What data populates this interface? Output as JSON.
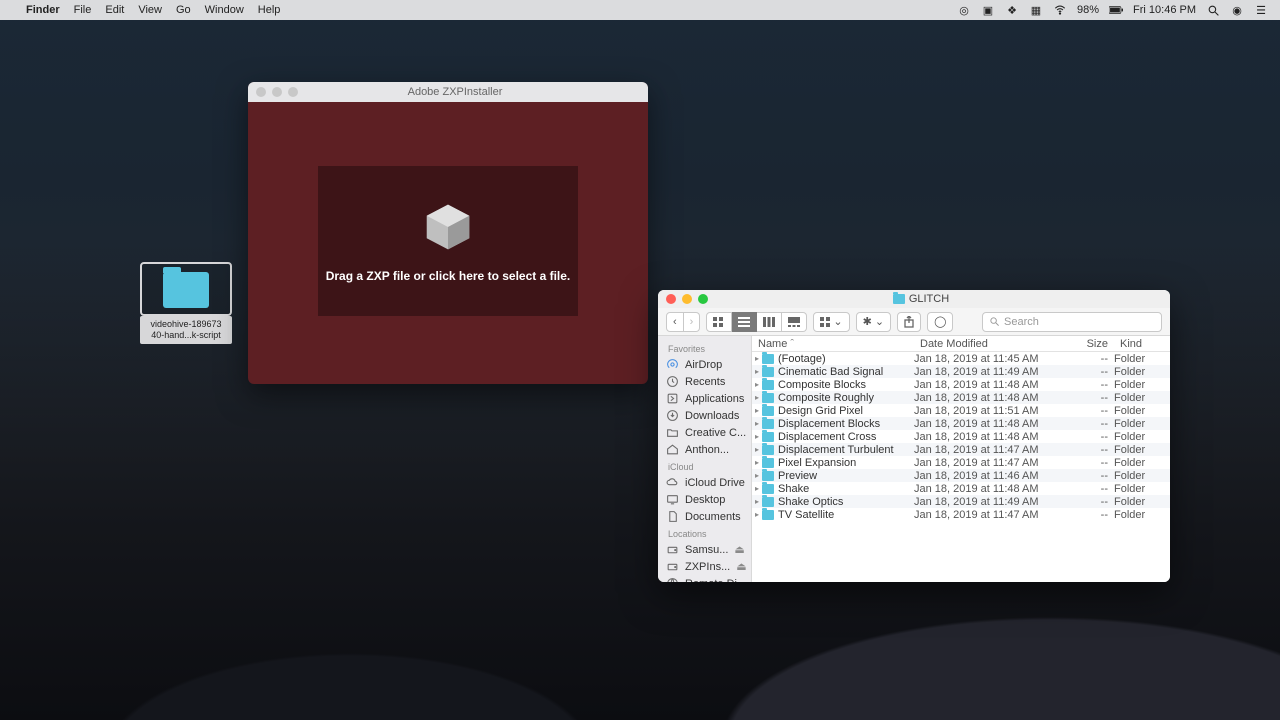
{
  "menubar": {
    "app": "Finder",
    "items": [
      "File",
      "Edit",
      "View",
      "Go",
      "Window",
      "Help"
    ],
    "battery": "98%",
    "clock": "Fri 10:46 PM"
  },
  "desktop": {
    "folder_label": "videohive-189673\n40-hand...k-script"
  },
  "zxp": {
    "title": "Adobe ZXPInstaller",
    "message": "Drag a ZXP file or click here to select a file."
  },
  "finder": {
    "title": "GLITCH",
    "search_placeholder": "Search",
    "sidebar": {
      "groups": [
        {
          "head": "Favorites",
          "items": [
            {
              "icon": "airdrop",
              "label": "AirDrop"
            },
            {
              "icon": "clock",
              "label": "Recents"
            },
            {
              "icon": "app",
              "label": "Applications"
            },
            {
              "icon": "download",
              "label": "Downloads"
            },
            {
              "icon": "folder",
              "label": "Creative C..."
            },
            {
              "icon": "home",
              "label": "Anthon..."
            }
          ]
        },
        {
          "head": "iCloud",
          "items": [
            {
              "icon": "cloud",
              "label": "iCloud Drive"
            },
            {
              "icon": "desktop",
              "label": "Desktop"
            },
            {
              "icon": "doc",
              "label": "Documents"
            }
          ]
        },
        {
          "head": "Locations",
          "items": [
            {
              "icon": "disk",
              "label": "Samsu...",
              "eject": true
            },
            {
              "icon": "disk",
              "label": "ZXPIns...",
              "eject": true
            },
            {
              "icon": "net",
              "label": "Remote Di..."
            }
          ]
        }
      ]
    },
    "columns": {
      "name": "Name",
      "date": "Date Modified",
      "size": "Size",
      "kind": "Kind"
    },
    "rows": [
      {
        "name": "(Footage)",
        "date": "Jan 18, 2019 at 11:45 AM",
        "size": "--",
        "kind": "Folder"
      },
      {
        "name": "Cinematic Bad Signal",
        "date": "Jan 18, 2019 at 11:49 AM",
        "size": "--",
        "kind": "Folder"
      },
      {
        "name": "Composite Blocks",
        "date": "Jan 18, 2019 at 11:48 AM",
        "size": "--",
        "kind": "Folder"
      },
      {
        "name": "Composite Roughly",
        "date": "Jan 18, 2019 at 11:48 AM",
        "size": "--",
        "kind": "Folder"
      },
      {
        "name": "Design Grid Pixel",
        "date": "Jan 18, 2019 at 11:51 AM",
        "size": "--",
        "kind": "Folder"
      },
      {
        "name": "Displacement Blocks",
        "date": "Jan 18, 2019 at 11:48 AM",
        "size": "--",
        "kind": "Folder"
      },
      {
        "name": "Displacement Cross",
        "date": "Jan 18, 2019 at 11:48 AM",
        "size": "--",
        "kind": "Folder"
      },
      {
        "name": "Displacement Turbulent",
        "date": "Jan 18, 2019 at 11:47 AM",
        "size": "--",
        "kind": "Folder"
      },
      {
        "name": "Pixel Expansion",
        "date": "Jan 18, 2019 at 11:47 AM",
        "size": "--",
        "kind": "Folder"
      },
      {
        "name": "Preview",
        "date": "Jan 18, 2019 at 11:46 AM",
        "size": "--",
        "kind": "Folder"
      },
      {
        "name": "Shake",
        "date": "Jan 18, 2019 at 11:48 AM",
        "size": "--",
        "kind": "Folder"
      },
      {
        "name": "Shake Optics",
        "date": "Jan 18, 2019 at 11:49 AM",
        "size": "--",
        "kind": "Folder"
      },
      {
        "name": "TV Satellite",
        "date": "Jan 18, 2019 at 11:47 AM",
        "size": "--",
        "kind": "Folder"
      }
    ]
  }
}
